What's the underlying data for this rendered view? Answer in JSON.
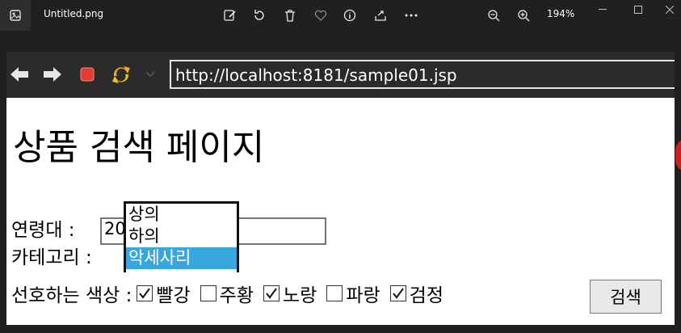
{
  "viewer": {
    "file_name": "Untitled.png",
    "zoom": "194%",
    "icons": [
      "app-icon",
      "edit-image-icon",
      "rotate-icon",
      "delete-icon",
      "favorite-icon",
      "info-icon",
      "share-icon",
      "more-icon",
      "zoom-out-icon",
      "zoom-in-icon"
    ],
    "window_controls": [
      "minimize",
      "maximize",
      "close"
    ]
  },
  "browser": {
    "url": "http://localhost:8181/sample01.jsp"
  },
  "page": {
    "title": "상품 검색 페이지",
    "age_label": "연령대 :",
    "age_value": "20",
    "category_label": "카테고리 :",
    "category_options": [
      "상의",
      "하의",
      "악세사리"
    ],
    "category_selected": "악세사리",
    "color_label": "선호하는 색상 :",
    "colors": [
      {
        "label": "빨강",
        "checked": true
      },
      {
        "label": "주황",
        "checked": false
      },
      {
        "label": "노랑",
        "checked": true
      },
      {
        "label": "파랑",
        "checked": false
      },
      {
        "label": "검정",
        "checked": true
      }
    ],
    "search_button": "검색"
  },
  "colors": {
    "viewer_bg": "#202020",
    "browser_bar": "#2b2b2b",
    "selected_option": "#3aa6df",
    "stop_red": "#e53935"
  }
}
